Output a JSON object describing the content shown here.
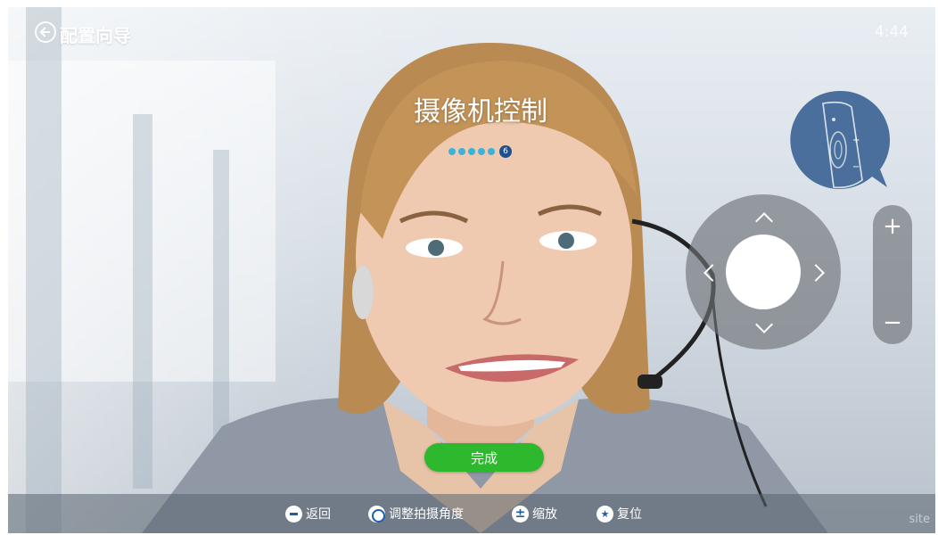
{
  "header": {
    "title": "配置向导",
    "back_icon": "back-arrow-circle-icon",
    "clock": "4:44"
  },
  "wizard": {
    "title": "摄像机控制",
    "total_steps": 6,
    "current_step": "6",
    "dot_color": "#3bb3d8",
    "current_color": "#1e4f8f"
  },
  "controls": {
    "remote_icon": "remote-control-icon",
    "dpad_icon": "dpad-icon",
    "zoom_plus": "+",
    "zoom_minus": "−"
  },
  "finish_button": {
    "label": "完成",
    "color": "#2eb82e"
  },
  "hints": [
    {
      "icon": "back-icon",
      "label": "返回"
    },
    {
      "icon": "direction-pad-icon",
      "label": "调整拍摄角度"
    },
    {
      "icon": "zoom-icon",
      "label": "缩放"
    },
    {
      "icon": "reset-icon",
      "label": "复位"
    }
  ],
  "watermark": "site"
}
